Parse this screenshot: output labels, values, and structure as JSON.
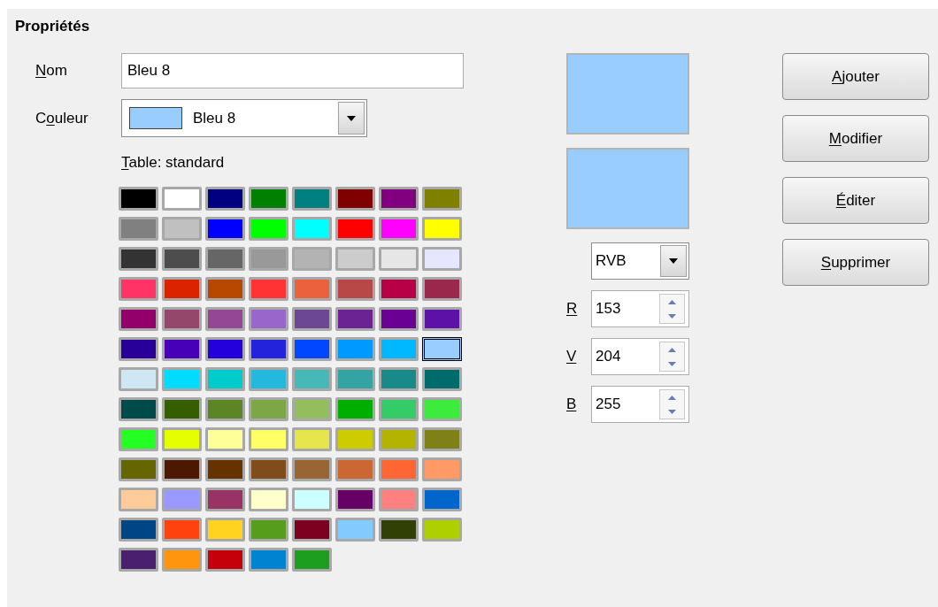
{
  "section_title": "Propriétés",
  "name_field": {
    "label": [
      {
        "text": "N",
        "underlined": true
      },
      {
        "text": "om",
        "underlined": false
      }
    ],
    "value": "Bleu 8"
  },
  "color_field": {
    "label": [
      {
        "text": "C",
        "underlined": false
      },
      {
        "text": "o",
        "underlined": true
      },
      {
        "text": "uleur",
        "underlined": false
      }
    ],
    "value": "Bleu 8",
    "color": "#99ccff"
  },
  "table_label": [
    {
      "text": "T",
      "underlined": true
    },
    {
      "text": "able: standard",
      "underlined": false
    }
  ],
  "palette": [
    {
      "color": "#000000",
      "selected": false
    },
    {
      "color": "#ffffff",
      "selected": false
    },
    {
      "color": "#000080",
      "selected": false
    },
    {
      "color": "#008000",
      "selected": false
    },
    {
      "color": "#008080",
      "selected": false
    },
    {
      "color": "#800000",
      "selected": false
    },
    {
      "color": "#800080",
      "selected": false
    },
    {
      "color": "#808000",
      "selected": false
    },
    {
      "color": "#808080",
      "selected": false
    },
    {
      "color": "#c0c0c0",
      "selected": false
    },
    {
      "color": "#0000ff",
      "selected": false
    },
    {
      "color": "#00ff00",
      "selected": false
    },
    {
      "color": "#00ffff",
      "selected": false
    },
    {
      "color": "#ff0000",
      "selected": false
    },
    {
      "color": "#ff00ff",
      "selected": false
    },
    {
      "color": "#ffff00",
      "selected": false
    },
    {
      "color": "#333333",
      "selected": false
    },
    {
      "color": "#4d4d4d",
      "selected": false
    },
    {
      "color": "#666666",
      "selected": false
    },
    {
      "color": "#999999",
      "selected": false
    },
    {
      "color": "#b3b3b3",
      "selected": false
    },
    {
      "color": "#cccccc",
      "selected": false
    },
    {
      "color": "#e6e6e6",
      "selected": false
    },
    {
      "color": "#e6e6ff",
      "selected": false
    },
    {
      "color": "#ff3366",
      "selected": false
    },
    {
      "color": "#dc2300",
      "selected": false
    },
    {
      "color": "#b84700",
      "selected": false
    },
    {
      "color": "#ff3333",
      "selected": false
    },
    {
      "color": "#eb613d",
      "selected": false
    },
    {
      "color": "#b84747",
      "selected": false
    },
    {
      "color": "#b80047",
      "selected": false
    },
    {
      "color": "#99284c",
      "selected": false
    },
    {
      "color": "#94006b",
      "selected": false
    },
    {
      "color": "#94476b",
      "selected": false
    },
    {
      "color": "#944794",
      "selected": false
    },
    {
      "color": "#9966cc",
      "selected": false
    },
    {
      "color": "#6b4794",
      "selected": false
    },
    {
      "color": "#6b2394",
      "selected": false
    },
    {
      "color": "#6b0094",
      "selected": false
    },
    {
      "color": "#5e11a6",
      "selected": false
    },
    {
      "color": "#280099",
      "selected": false
    },
    {
      "color": "#4700b8",
      "selected": false
    },
    {
      "color": "#2300dc",
      "selected": false
    },
    {
      "color": "#2323dc",
      "selected": false
    },
    {
      "color": "#0047ff",
      "selected": false
    },
    {
      "color": "#0099ff",
      "selected": false
    },
    {
      "color": "#00b8ff",
      "selected": false
    },
    {
      "color": "#99ccff",
      "selected": true
    },
    {
      "color": "#cfe7f5",
      "selected": false
    },
    {
      "color": "#00dcff",
      "selected": false
    },
    {
      "color": "#00cccc",
      "selected": false
    },
    {
      "color": "#23b8dc",
      "selected": false
    },
    {
      "color": "#47b8b8",
      "selected": false
    },
    {
      "color": "#33a3a3",
      "selected": false
    },
    {
      "color": "#198a8a",
      "selected": false
    },
    {
      "color": "#006b6b",
      "selected": false
    },
    {
      "color": "#004a4a",
      "selected": false
    },
    {
      "color": "#355e00",
      "selected": false
    },
    {
      "color": "#5c8526",
      "selected": false
    },
    {
      "color": "#7da647",
      "selected": false
    },
    {
      "color": "#94bd5e",
      "selected": false
    },
    {
      "color": "#00ae00",
      "selected": false
    },
    {
      "color": "#33cc66",
      "selected": false
    },
    {
      "color": "#3deb3d",
      "selected": false
    },
    {
      "color": "#23ff23",
      "selected": false
    },
    {
      "color": "#e6ff00",
      "selected": false
    },
    {
      "color": "#ffff99",
      "selected": false
    },
    {
      "color": "#ffff66",
      "selected": false
    },
    {
      "color": "#e6e64c",
      "selected": false
    },
    {
      "color": "#cccc00",
      "selected": false
    },
    {
      "color": "#b3b300",
      "selected": false
    },
    {
      "color": "#808019",
      "selected": false
    },
    {
      "color": "#666600",
      "selected": false
    },
    {
      "color": "#4c1900",
      "selected": false
    },
    {
      "color": "#663300",
      "selected": false
    },
    {
      "color": "#804c19",
      "selected": false
    },
    {
      "color": "#996633",
      "selected": false
    },
    {
      "color": "#cc6633",
      "selected": false
    },
    {
      "color": "#ff6633",
      "selected": false
    },
    {
      "color": "#ff9966",
      "selected": false
    },
    {
      "color": "#ffcc99",
      "selected": false
    },
    {
      "color": "#9999ff",
      "selected": false
    },
    {
      "color": "#993366",
      "selected": false
    },
    {
      "color": "#ffffcc",
      "selected": false
    },
    {
      "color": "#ccffff",
      "selected": false
    },
    {
      "color": "#660066",
      "selected": false
    },
    {
      "color": "#ff8080",
      "selected": false
    },
    {
      "color": "#0066cc",
      "selected": false
    },
    {
      "color": "#004586",
      "selected": false
    },
    {
      "color": "#ff420e",
      "selected": false
    },
    {
      "color": "#ffd320",
      "selected": false
    },
    {
      "color": "#579d1c",
      "selected": false
    },
    {
      "color": "#7e0021",
      "selected": false
    },
    {
      "color": "#83caff",
      "selected": false
    },
    {
      "color": "#314004",
      "selected": false
    },
    {
      "color": "#aecf00",
      "selected": false
    },
    {
      "color": "#4b1f6f",
      "selected": false
    },
    {
      "color": "#ff950e",
      "selected": false
    },
    {
      "color": "#c5000b",
      "selected": false
    },
    {
      "color": "#0084d1",
      "selected": false
    },
    {
      "color": "#1e9e1e",
      "selected": false
    }
  ],
  "previews": [
    {
      "color": "#99ccff"
    },
    {
      "color": "#99ccff"
    }
  ],
  "color_model": {
    "value": "RVB"
  },
  "channels": [
    {
      "label": [
        {
          "text": "R",
          "underlined": true
        }
      ],
      "value": "153"
    },
    {
      "label": [
        {
          "text": "V",
          "underlined": true
        }
      ],
      "value": "204"
    },
    {
      "label": [
        {
          "text": "B",
          "underlined": true
        }
      ],
      "value": "255"
    }
  ],
  "buttons": [
    {
      "label": [
        {
          "text": "A",
          "underlined": true
        },
        {
          "text": "jouter",
          "underlined": false
        }
      ]
    },
    {
      "label": [
        {
          "text": "M",
          "underlined": true
        },
        {
          "text": "odifier",
          "underlined": false
        }
      ]
    },
    {
      "label": [
        {
          "text": "É",
          "underlined": true
        },
        {
          "text": "diter",
          "underlined": false
        }
      ]
    },
    {
      "label": [
        {
          "text": "S",
          "underlined": true
        },
        {
          "text": "upprimer",
          "underlined": false
        }
      ]
    }
  ]
}
